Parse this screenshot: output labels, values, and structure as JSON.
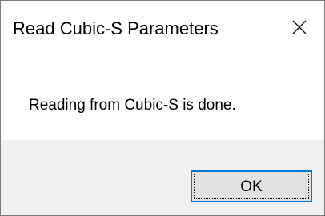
{
  "window": {
    "title": "Read Cubic-S Parameters",
    "close_icon": "close-icon"
  },
  "content": {
    "message": "Reading from Cubic-S is done."
  },
  "footer": {
    "ok_label": "OK"
  },
  "colors": {
    "focus_border": "#0078d7",
    "footer_background": "#f0f0f0",
    "button_background": "#e1e1e1"
  }
}
